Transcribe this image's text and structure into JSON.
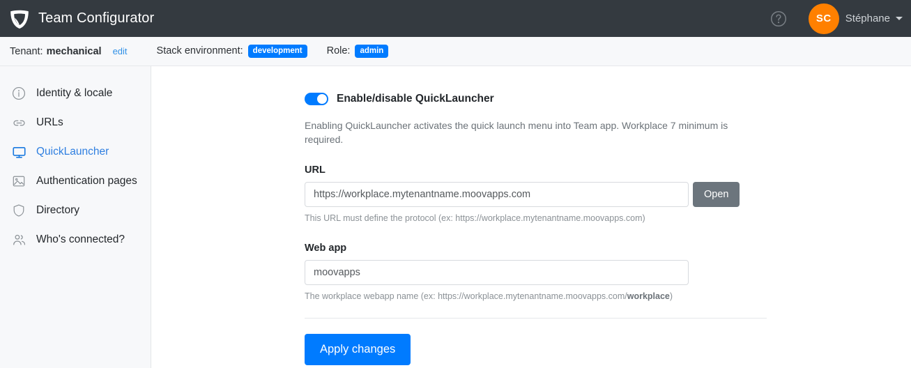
{
  "appbar": {
    "logo_icon": "shield-logo-icon",
    "title": "Team Configurator",
    "help_icon": "question-circle-icon",
    "avatar_initials": "SC",
    "user_name": "Stéphane",
    "caret_icon": "chevron-down-icon"
  },
  "subbar": {
    "tenant_label": "Tenant:",
    "tenant_value": "mechanical",
    "edit_link": "edit",
    "stack_label": "Stack environment:",
    "stack_badge": "development",
    "role_label": "Role:",
    "role_badge": "admin",
    "badge_color": "#007bff"
  },
  "sidebar": {
    "items": [
      {
        "label": "Identity & locale",
        "icon": "info-circle-icon",
        "active": false
      },
      {
        "label": "URLs",
        "icon": "link-icon",
        "active": false
      },
      {
        "label": "QuickLauncher",
        "icon": "monitor-icon",
        "active": true
      },
      {
        "label": "Authentication pages",
        "icon": "image-icon",
        "active": false
      },
      {
        "label": "Directory",
        "icon": "shield-icon",
        "active": false
      },
      {
        "label": "Who's connected?",
        "icon": "users-icon",
        "active": false
      }
    ],
    "active_color": "#2f7fe0"
  },
  "main": {
    "toggle": {
      "label": "Enable/disable QuickLauncher",
      "enabled": true,
      "on_color": "#007bff"
    },
    "intro": "Enabling QuickLauncher activates the quick launch menu into Team app. Workplace 7 minimum is required.",
    "url_field": {
      "label": "URL",
      "value": "https://workplace.mytenantname.moovapps.com",
      "placeholder": "",
      "hint": "This URL must define the protocol (ex: https://workplace.mytenantname.moovapps.com)",
      "open_button": "Open"
    },
    "webapp_field": {
      "label": "Web app",
      "value": "moovapps",
      "placeholder": "",
      "hint_prefix": "The workplace webapp name (ex: https://workplace.mytenantname.moovapps.com/",
      "hint_bold": "workplace",
      "hint_suffix": ")"
    },
    "apply_button": "Apply changes"
  }
}
